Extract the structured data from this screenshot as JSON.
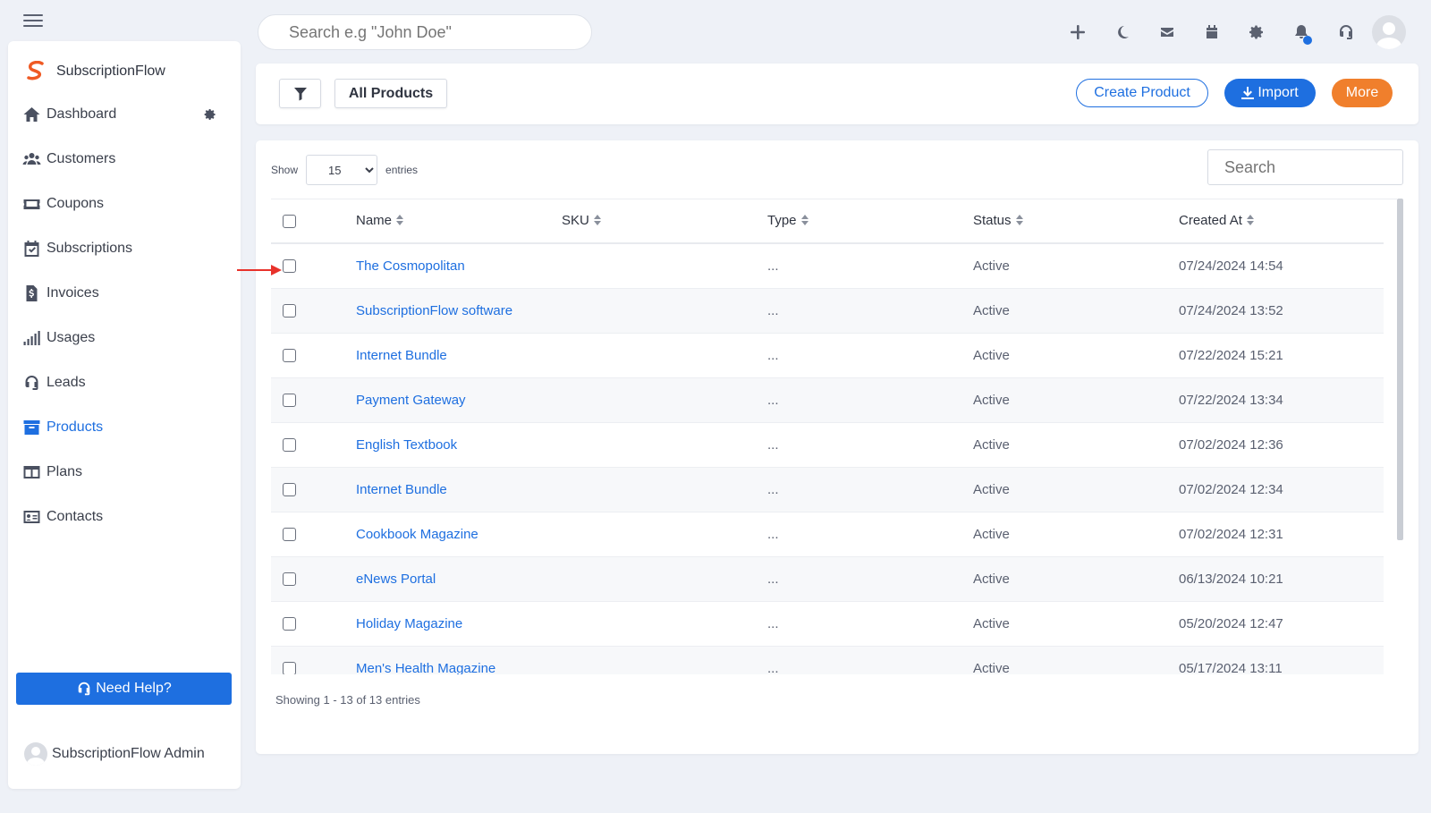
{
  "header": {
    "search_placeholder": "Search e.g \"John Doe\""
  },
  "brand": {
    "name": "SubscriptionFlow"
  },
  "sidebar": {
    "items": [
      {
        "label": "Dashboard",
        "icon": "home-icon"
      },
      {
        "label": "Customers",
        "icon": "users-icon"
      },
      {
        "label": "Coupons",
        "icon": "ticket-icon"
      },
      {
        "label": "Subscriptions",
        "icon": "calendar-check-icon"
      },
      {
        "label": "Invoices",
        "icon": "invoice-icon"
      },
      {
        "label": "Usages",
        "icon": "signal-bars-icon"
      },
      {
        "label": "Leads",
        "icon": "headset-icon"
      },
      {
        "label": "Products",
        "icon": "archive-box-icon",
        "active": true
      },
      {
        "label": "Plans",
        "icon": "columns-icon"
      },
      {
        "label": "Contacts",
        "icon": "address-card-icon"
      }
    ],
    "help_label": "Need Help?",
    "admin_name": "SubscriptionFlow Admin"
  },
  "toolbar": {
    "all_products_label": "All Products",
    "create_label": "Create Product",
    "import_label": "Import",
    "more_label": "More"
  },
  "table": {
    "show_label": "Show",
    "entries_value": "15",
    "entries_label": "entries",
    "search_placeholder": "Search",
    "columns": [
      "Name",
      "SKU",
      "Type",
      "Status",
      "Created At"
    ],
    "rows": [
      {
        "name": "The Cosmopolitan",
        "sku": "",
        "type": "...",
        "status": "Active",
        "created": "07/24/2024 14:54"
      },
      {
        "name": "SubscriptionFlow software",
        "sku": "",
        "type": "...",
        "status": "Active",
        "created": "07/24/2024 13:52"
      },
      {
        "name": "Internet Bundle",
        "sku": "",
        "type": "...",
        "status": "Active",
        "created": "07/22/2024 15:21"
      },
      {
        "name": "Payment Gateway",
        "sku": "",
        "type": "...",
        "status": "Active",
        "created": "07/22/2024 13:34"
      },
      {
        "name": "English Textbook",
        "sku": "",
        "type": "...",
        "status": "Active",
        "created": "07/02/2024 12:36"
      },
      {
        "name": "Internet Bundle",
        "sku": "",
        "type": "...",
        "status": "Active",
        "created": "07/02/2024 12:34"
      },
      {
        "name": "Cookbook Magazine",
        "sku": "",
        "type": "...",
        "status": "Active",
        "created": "07/02/2024 12:31"
      },
      {
        "name": "eNews Portal",
        "sku": "",
        "type": "...",
        "status": "Active",
        "created": "06/13/2024 10:21"
      },
      {
        "name": "Holiday Magazine",
        "sku": "",
        "type": "...",
        "status": "Active",
        "created": "05/20/2024 12:47"
      },
      {
        "name": "Men's Health Magazine",
        "sku": "",
        "type": "...",
        "status": "Active",
        "created": "05/17/2024 13:11"
      }
    ],
    "footer": "Showing 1 - 13 of 13 entries"
  },
  "colors": {
    "accent": "#1e6fe0",
    "more": "#f07f2c",
    "annotation_arrow": "#e8322b"
  }
}
